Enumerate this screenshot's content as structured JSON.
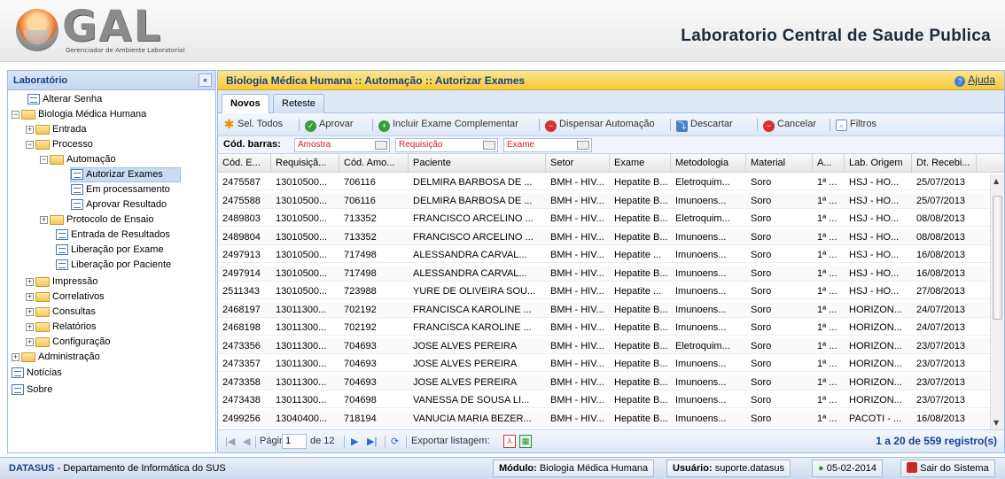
{
  "header": {
    "logo_text": "GAL",
    "logo_subtitle": "Gerenciador de Ambiente Laboratorial",
    "title": "Laboratorio Central de Saude Publica"
  },
  "sidebar": {
    "title": "Laboratório",
    "collapse_icon": "«",
    "items": [
      {
        "label": "Alterar Senha"
      },
      {
        "label": "Biologia Médica Humana"
      },
      {
        "label": "Entrada"
      },
      {
        "label": "Processo"
      },
      {
        "label": "Automação"
      },
      {
        "label": "Autorizar Exames"
      },
      {
        "label": "Em processamento"
      },
      {
        "label": "Aprovar Resultado"
      },
      {
        "label": "Protocolo de Ensaio"
      },
      {
        "label": "Entrada de Resultados"
      },
      {
        "label": "Liberação por Exame"
      },
      {
        "label": "Liberação por Paciente"
      },
      {
        "label": "Impressão"
      },
      {
        "label": "Correlativos"
      },
      {
        "label": "Consultas"
      },
      {
        "label": "Relatórios"
      },
      {
        "label": "Configuração"
      },
      {
        "label": "Administração"
      },
      {
        "label": "Notícias"
      },
      {
        "label": "Sobre"
      }
    ]
  },
  "main": {
    "title": "Biologia Médica Humana :: Automação :: Autorizar Exames",
    "help_label": "Ajuda",
    "tabs": [
      {
        "label": "Novos"
      },
      {
        "label": "Reteste"
      }
    ],
    "toolbar": {
      "select_all": "Sel. Todos",
      "approve": "Aprovar",
      "include_exam": "Incluir Exame Complementar",
      "dispense": "Dispensar Automação",
      "discard": "Descartar",
      "cancel": "Cancelar",
      "filters": "Filtros"
    },
    "barcodes": {
      "label": "Cód. barras:",
      "sample": "Amostra",
      "request": "Requisição",
      "exam": "Exame"
    },
    "columns": [
      "Cód. E...",
      "Requisiçã...",
      "Cód. Amo...",
      "Paciente",
      "Setor",
      "Exame",
      "Metodologia",
      "Material",
      "A...",
      "Lab. Origem",
      "Dt. Recebi..."
    ],
    "rows": [
      [
        "2475587",
        "13010500...",
        "706116",
        "DELMIRA BARBOSA DE ...",
        "BMH - HIV...",
        "Hepatite B...",
        "Eletroquim...",
        "Soro",
        "1ª ...",
        "HSJ - HO...",
        "25/07/2013"
      ],
      [
        "2475588",
        "13010500...",
        "706116",
        "DELMIRA BARBOSA DE ...",
        "BMH - HIV...",
        "Hepatite B...",
        "Imunoens...",
        "Soro",
        "1ª ...",
        "HSJ - HO...",
        "25/07/2013"
      ],
      [
        "2489803",
        "13010500...",
        "713352",
        "FRANCISCO ARCELINO ...",
        "BMH - HIV...",
        "Hepatite B...",
        "Eletroquim...",
        "Soro",
        "1ª ...",
        "HSJ - HO...",
        "08/08/2013"
      ],
      [
        "2489804",
        "13010500...",
        "713352",
        "FRANCISCO ARCELINO ...",
        "BMH - HIV...",
        "Hepatite B...",
        "Imunoens...",
        "Soro",
        "1ª ...",
        "HSJ - HO...",
        "08/08/2013"
      ],
      [
        "2497913",
        "13010500...",
        "717498",
        "ALESSANDRA CARVAL...",
        "BMH - HIV...",
        "Hepatite ...",
        "Imunoens...",
        "Soro",
        "1ª ...",
        "HSJ - HO...",
        "16/08/2013"
      ],
      [
        "2497914",
        "13010500...",
        "717498",
        "ALESSANDRA CARVAL...",
        "BMH - HIV...",
        "Hepatite B...",
        "Imunoens...",
        "Soro",
        "1ª ...",
        "HSJ - HO...",
        "16/08/2013"
      ],
      [
        "2511343",
        "13010500...",
        "723988",
        "YURE DE OLIVEIRA SOU...",
        "BMH - HIV...",
        "Hepatite ...",
        "Imunoens...",
        "Soro",
        "1ª ...",
        "HSJ - HO...",
        "27/08/2013"
      ],
      [
        "2468197",
        "13011300...",
        "702192",
        "FRANCISCA KAROLINE ...",
        "BMH - HIV...",
        "Hepatite B...",
        "Imunoens...",
        "Soro",
        "1ª ...",
        "HORIZON...",
        "24/07/2013"
      ],
      [
        "2468198",
        "13011300...",
        "702192",
        "FRANCISCA KAROLINE ...",
        "BMH - HIV...",
        "Hepatite B...",
        "Imunoens...",
        "Soro",
        "1ª ...",
        "HORIZON...",
        "24/07/2013"
      ],
      [
        "2473356",
        "13011300...",
        "704693",
        "JOSE ALVES PEREIRA",
        "BMH - HIV...",
        "Hepatite B...",
        "Eletroquim...",
        "Soro",
        "1ª ...",
        "HORIZON...",
        "23/07/2013"
      ],
      [
        "2473357",
        "13011300...",
        "704693",
        "JOSE ALVES PEREIRA",
        "BMH - HIV...",
        "Hepatite B...",
        "Imunoens...",
        "Soro",
        "1ª ...",
        "HORIZON...",
        "23/07/2013"
      ],
      [
        "2473358",
        "13011300...",
        "704693",
        "JOSE ALVES PEREIRA",
        "BMH - HIV...",
        "Hepatite B...",
        "Imunoens...",
        "Soro",
        "1ª ...",
        "HORIZON...",
        "23/07/2013"
      ],
      [
        "2473438",
        "13011300...",
        "704698",
        "VANESSA DE SOUSA LI...",
        "BMH - HIV...",
        "Hepatite B...",
        "Imunoens...",
        "Soro",
        "1ª ...",
        "HORIZON...",
        "23/07/2013"
      ],
      [
        "2499256",
        "13040400...",
        "718194",
        "VANUCIA MARIA BEZER...",
        "BMH - HIV...",
        "Hepatite B...",
        "Imunoens...",
        "Soro",
        "1ª ...",
        "PACOTI - ...",
        "16/08/2013"
      ]
    ],
    "pager": {
      "page_label": "Página",
      "page_value": "1",
      "of_label": "de 12",
      "export_label": "Exportar listagem:",
      "count_label": "1 a 20 de 559 registro(s)"
    }
  },
  "footer": {
    "brand": "DATASUS",
    "brand_desc": " - Departamento de Informática do SUS",
    "module_label": "Módulo:",
    "module_value": "Biologia Médica Humana",
    "user_label": "Usuário:",
    "user_value": "suporte.datasus",
    "date": "05-02-2014",
    "logout": "Sair do Sistema"
  },
  "colors": {
    "accent_blue": "#15428b",
    "header_yellow": "#f6c938",
    "status_red": "#d42020"
  }
}
